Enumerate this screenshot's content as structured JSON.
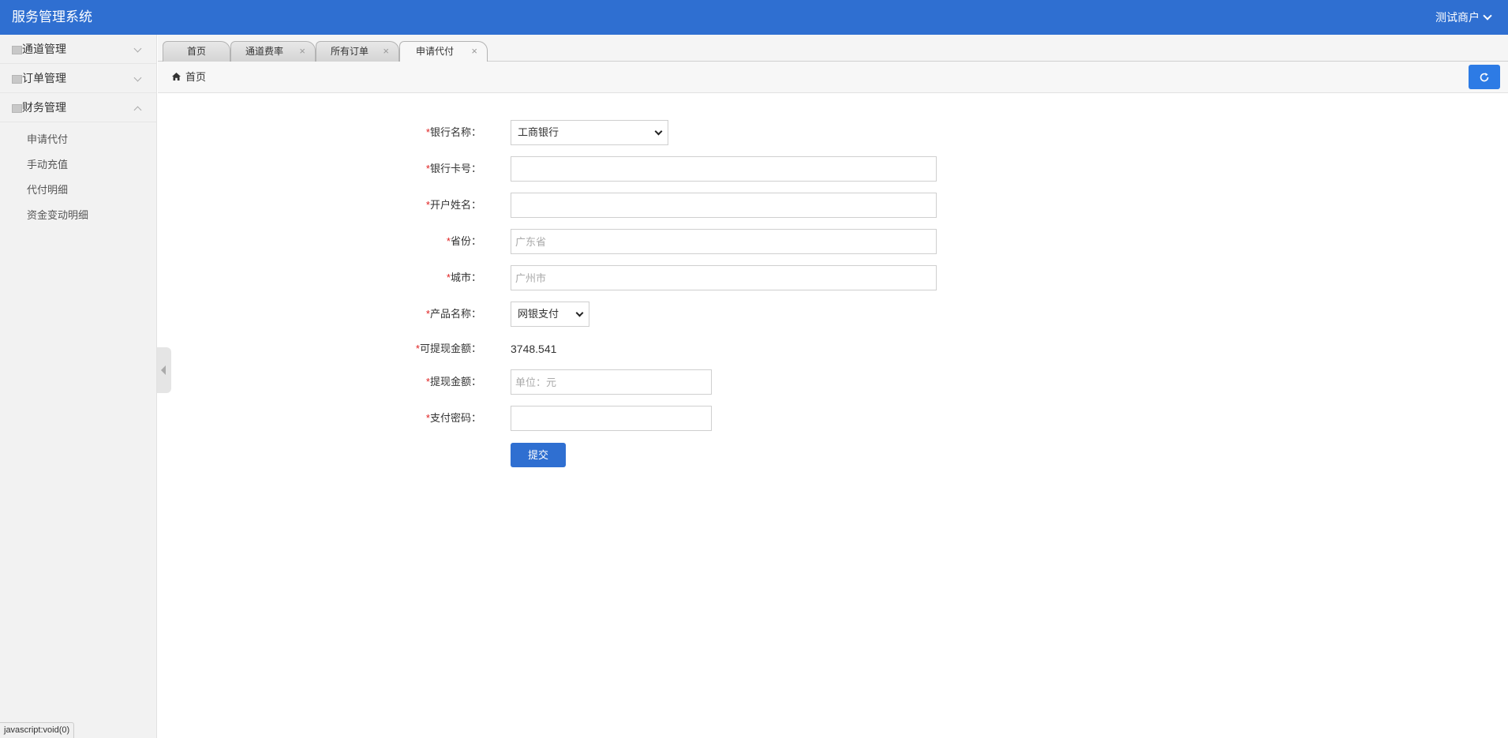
{
  "header": {
    "app_title": "服务管理系统",
    "user_name": "测试商户"
  },
  "sidebar": {
    "groups": [
      {
        "label": "通道管理",
        "expanded": false
      },
      {
        "label": "订单管理",
        "expanded": false
      },
      {
        "label": "财务管理",
        "expanded": true,
        "items": [
          "申请代付",
          "手动充值",
          "代付明细",
          "资金变动明细"
        ]
      }
    ]
  },
  "tabs": [
    {
      "label": "首页",
      "closable": false
    },
    {
      "label": "通道费率",
      "closable": true
    },
    {
      "label": "所有订单",
      "closable": true
    },
    {
      "label": "申请代付",
      "closable": true,
      "active": true
    }
  ],
  "close_glyph": "×",
  "breadcrumb": {
    "home": "首页"
  },
  "form": {
    "required_mark": "*",
    "bank_name": {
      "label": "银行名称：",
      "value": "工商银行"
    },
    "card_number": {
      "label": "银行卡号：",
      "value": ""
    },
    "account_name": {
      "label": "开户姓名：",
      "value": ""
    },
    "province": {
      "label": "省份：",
      "placeholder": "广东省"
    },
    "city": {
      "label": "城市：",
      "placeholder": "广州市"
    },
    "product": {
      "label": "产品名称：",
      "value": "网银支付"
    },
    "available": {
      "label": "可提现金额：",
      "value": "3748.541"
    },
    "amount": {
      "label": "提现金额：",
      "placeholder": "单位：元"
    },
    "pay_password": {
      "label": "支付密码：",
      "value": ""
    },
    "submit_label": "提交"
  },
  "status_bar": {
    "text": "javascript:void(0)"
  },
  "colors": {
    "header_bg": "#2f6fd1",
    "accent": "#2d7be5",
    "required": "#e02020"
  },
  "icons": {
    "home": "home-icon",
    "refresh": "refresh-icon",
    "collapse": "collapse-left-icon",
    "user_menu": "chevron-down-icon"
  }
}
